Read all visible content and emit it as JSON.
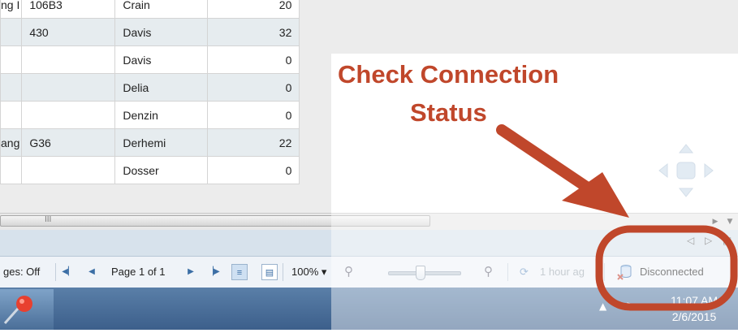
{
  "table": {
    "rows": [
      {
        "c1": "ng I",
        "c2": "106B3",
        "c3": "Crain",
        "c4": "20"
      },
      {
        "c1": "",
        "c2": "430",
        "c3": "Davis",
        "c4": "32"
      },
      {
        "c1": "",
        "c2": "",
        "c3": "Davis",
        "c4": "0"
      },
      {
        "c1": "",
        "c2": "",
        "c3": "Delia",
        "c4": "0"
      },
      {
        "c1": "",
        "c2": "",
        "c3": "Denzin",
        "c4": "0"
      },
      {
        "c1": "ang",
        "c2": "G36",
        "c3": "Derhemi",
        "c4": "22"
      },
      {
        "c1": "",
        "c2": "",
        "c3": "Dosser",
        "c4": "0"
      }
    ]
  },
  "scrollbar": {
    "grip": "III"
  },
  "statusbar": {
    "track_changes": "ges: Off",
    "page_label": "Page 1 of 1",
    "zoom": "100%",
    "last_refresh": "1 hour ag",
    "connection_status": "Disconnected",
    "connection_color": "#c0392b"
  },
  "taskbar": {
    "time": "11:07 AM",
    "date": "2/6/2015"
  },
  "annotation": {
    "line1": "Check Connection",
    "line2": "Status",
    "color": "#c0472b"
  }
}
